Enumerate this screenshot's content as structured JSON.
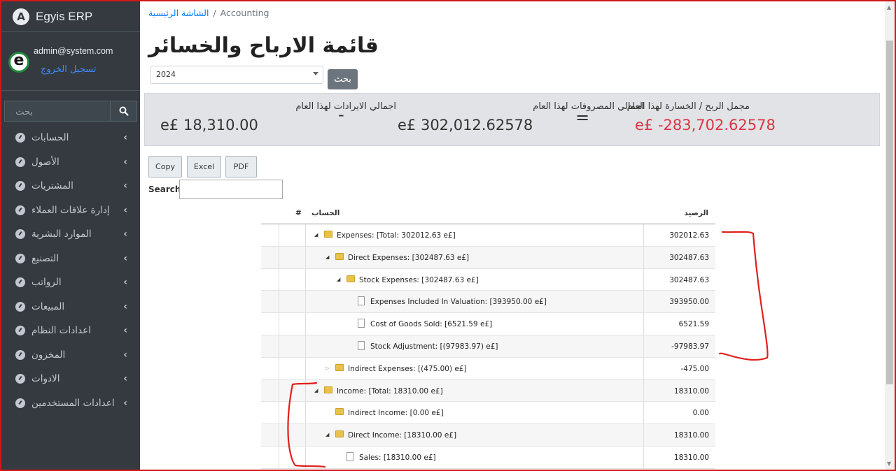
{
  "app": {
    "brand": "Egyis ERP",
    "brand_logo": "A"
  },
  "user": {
    "email": "admin@system.com",
    "logout": "تسجيل الخروج",
    "avatar": "e"
  },
  "sidebar_search": {
    "placeholder": "بحث"
  },
  "menu": [
    {
      "label": "الحسابات",
      "icon": "dashboard-icon"
    },
    {
      "label": "الأصول",
      "icon": "dashboard-icon"
    },
    {
      "label": "المشتريات",
      "icon": "dashboard-icon"
    },
    {
      "label": "إدارة علاقات العملاء",
      "icon": "dashboard-icon"
    },
    {
      "label": "الموارد البشرية",
      "icon": "dashboard-icon"
    },
    {
      "label": "التصنيع",
      "icon": "dashboard-icon"
    },
    {
      "label": "الرواتب",
      "icon": "dashboard-icon"
    },
    {
      "label": "المبيعات",
      "icon": "dashboard-icon"
    },
    {
      "label": "اعدادات النظام",
      "icon": "dashboard-icon"
    },
    {
      "label": "المخزون",
      "icon": "dashboard-icon"
    },
    {
      "label": "الادوات",
      "icon": "dashboard-icon"
    },
    {
      "label": "اعدادات المستخدمين",
      "icon": "dashboard-icon"
    }
  ],
  "breadcrumb": {
    "home": "الشاشة الرئيسية",
    "separator": "/",
    "current": "Accounting"
  },
  "page": {
    "title": "قائمة الارباح والخسائر",
    "year": "2024",
    "search_button": "بحث"
  },
  "summary": {
    "income_label": "اجمالي الايرادات لهذا العام",
    "income_value": "e£ 18,310.00",
    "minus": "-",
    "expense_label": "اجمالي المصروفات لهذا العام",
    "expense_value": "e£ 302,012.62578",
    "equals": "=",
    "net_label": "مجمل الربح / الخسارة لهذا العام",
    "net_value": "e£ -283,702.62578",
    "net_color": "#dc3545"
  },
  "export": {
    "copy": "Copy",
    "excel": "Excel",
    "pdf": "PDF"
  },
  "table_search": {
    "label": "Search:",
    "value": ""
  },
  "table": {
    "headers": {
      "hash": "#",
      "account": "الحساب",
      "balance": "الرصيد"
    },
    "rows": [
      {
        "depth": 0,
        "toggle": "expanded",
        "type": "folder",
        "account": "Expenses: [Total: 302012.63 e£]",
        "balance": "302012.63"
      },
      {
        "depth": 1,
        "toggle": "expanded",
        "type": "folder",
        "account": "Direct Expenses: [302487.63 e£]",
        "balance": "302487.63"
      },
      {
        "depth": 2,
        "toggle": "expanded",
        "type": "folder",
        "account": "Stock Expenses: [302487.63 e£]",
        "balance": "302487.63"
      },
      {
        "depth": 3,
        "toggle": "none",
        "type": "file",
        "account": "Expenses Included In Valuation: [393950.00 e£]",
        "balance": "393950.00"
      },
      {
        "depth": 3,
        "toggle": "none",
        "type": "file",
        "account": "Cost of Goods Sold: [6521.59 e£]",
        "balance": "6521.59"
      },
      {
        "depth": 3,
        "toggle": "none",
        "type": "file",
        "account": "Stock Adjustment: [(97983.97) e£]",
        "balance": "-97983.97"
      },
      {
        "depth": 1,
        "toggle": "collapsed",
        "type": "folder",
        "account": "Indirect Expenses: [(475.00) e£]",
        "balance": "-475.00"
      },
      {
        "depth": 0,
        "toggle": "expanded",
        "type": "folder",
        "account": "Income: [Total: 18310.00 e£]",
        "balance": "18310.00"
      },
      {
        "depth": 1,
        "toggle": "none",
        "type": "folder",
        "account": "Indirect Income: [0.00 e£]",
        "balance": "0.00"
      },
      {
        "depth": 1,
        "toggle": "expanded",
        "type": "folder",
        "account": "Direct Income: [18310.00 e£]",
        "balance": "18310.00"
      },
      {
        "depth": 2,
        "toggle": "none",
        "type": "file",
        "account": "Sales: [18310.00 e£]",
        "balance": "18310.00"
      }
    ]
  }
}
